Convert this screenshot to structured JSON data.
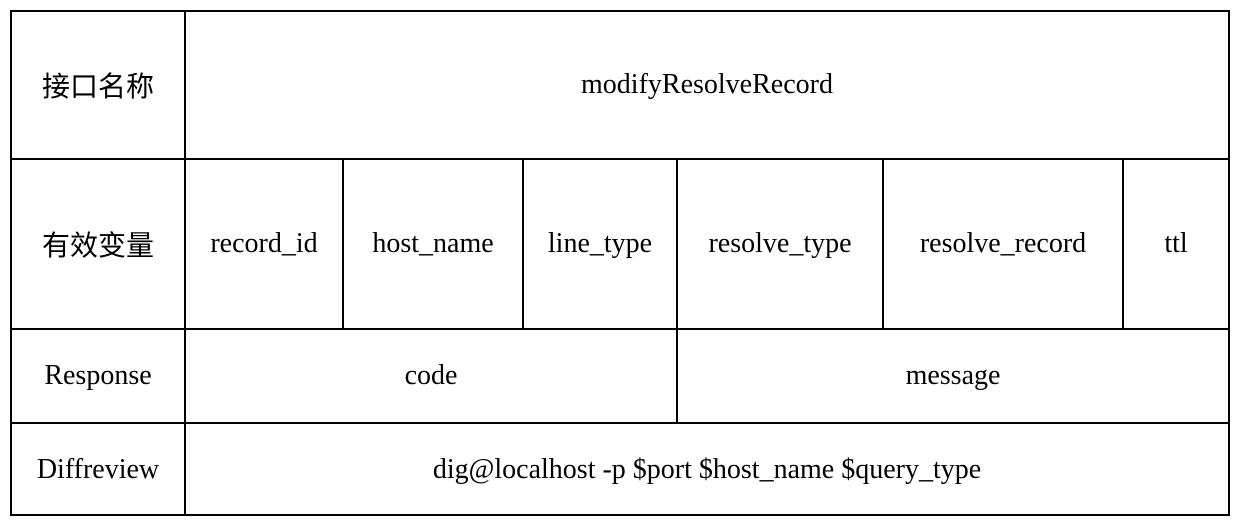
{
  "rows": {
    "row1": {
      "label": "接口名称",
      "value": "modifyResolveRecord"
    },
    "row2": {
      "label": "有效变量",
      "cells": {
        "c1": "record_id",
        "c2": "host_name",
        "c3": "line_type",
        "c4": "resolve_type",
        "c5": "resolve_record",
        "c6": "ttl"
      }
    },
    "row3": {
      "label": "Response",
      "cells": {
        "code": "code",
        "message": "message"
      }
    },
    "row4": {
      "label": "Diffreview",
      "value": "dig@localhost -p $port $host_name $query_type"
    }
  }
}
